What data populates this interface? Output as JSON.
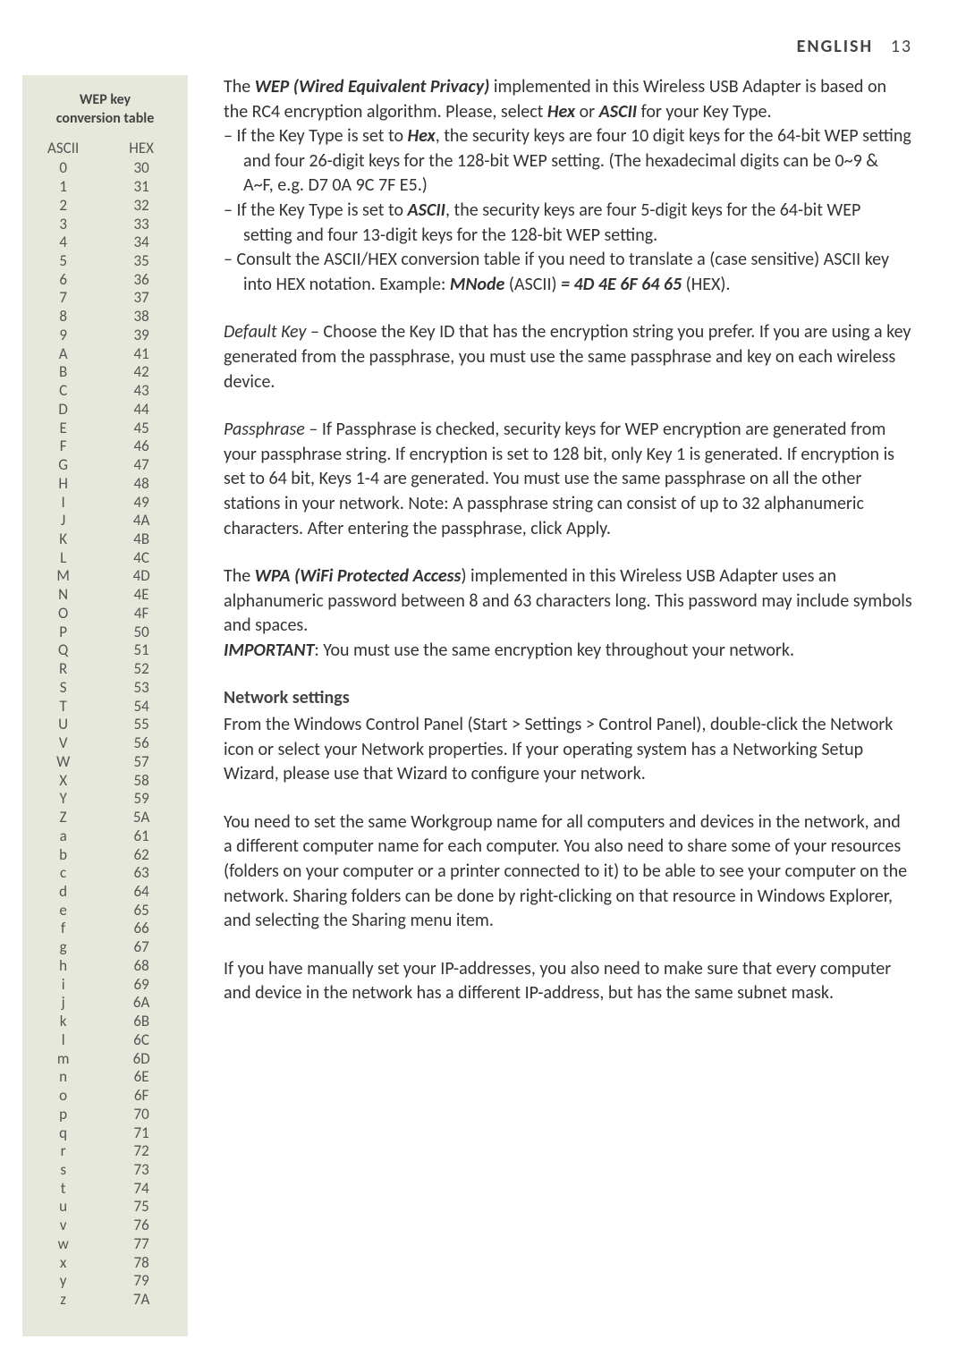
{
  "header": {
    "lang": "ENGLISH",
    "pagenum": "13"
  },
  "sidebar": {
    "title_l1": "WEP key",
    "title_l2": "conversion table",
    "cols": {
      "ascii_head": "ASCII",
      "hex_head": "HEX"
    },
    "rows": [
      {
        "a": "0",
        "h": "30"
      },
      {
        "a": "1",
        "h": "31"
      },
      {
        "a": "2",
        "h": "32"
      },
      {
        "a": "3",
        "h": "33"
      },
      {
        "a": "4",
        "h": "34"
      },
      {
        "a": "5",
        "h": "35"
      },
      {
        "a": "6",
        "h": "36"
      },
      {
        "a": "7",
        "h": "37"
      },
      {
        "a": "8",
        "h": "38"
      },
      {
        "a": "9",
        "h": "39"
      },
      {
        "a": "A",
        "h": "41"
      },
      {
        "a": "B",
        "h": "42"
      },
      {
        "a": "C",
        "h": "43"
      },
      {
        "a": "D",
        "h": "44"
      },
      {
        "a": "E",
        "h": "45"
      },
      {
        "a": "F",
        "h": "46"
      },
      {
        "a": "G",
        "h": "47"
      },
      {
        "a": "H",
        "h": "48"
      },
      {
        "a": "I",
        "h": "49"
      },
      {
        "a": "J",
        "h": "4A"
      },
      {
        "a": "K",
        "h": "4B"
      },
      {
        "a": "L",
        "h": "4C"
      },
      {
        "a": "M",
        "h": "4D"
      },
      {
        "a": "N",
        "h": "4E"
      },
      {
        "a": "O",
        "h": "4F"
      },
      {
        "a": "P",
        "h": "50"
      },
      {
        "a": "Q",
        "h": "51"
      },
      {
        "a": "R",
        "h": "52"
      },
      {
        "a": "S",
        "h": "53"
      },
      {
        "a": "T",
        "h": "54"
      },
      {
        "a": "U",
        "h": "55"
      },
      {
        "a": "V",
        "h": "56"
      },
      {
        "a": "W",
        "h": "57"
      },
      {
        "a": "X",
        "h": "58"
      },
      {
        "a": "Y",
        "h": "59"
      },
      {
        "a": "Z",
        "h": "5A"
      },
      {
        "a": "a",
        "h": "61"
      },
      {
        "a": "b",
        "h": "62"
      },
      {
        "a": "c",
        "h": "63"
      },
      {
        "a": "d",
        "h": "64"
      },
      {
        "a": "e",
        "h": "65"
      },
      {
        "a": "f",
        "h": "66"
      },
      {
        "a": "g",
        "h": "67"
      },
      {
        "a": "h",
        "h": "68"
      },
      {
        "a": "i",
        "h": "69"
      },
      {
        "a": "j",
        "h": "6A"
      },
      {
        "a": "k",
        "h": "6B"
      },
      {
        "a": "l",
        "h": "6C"
      },
      {
        "a": "m",
        "h": "6D"
      },
      {
        "a": "n",
        "h": "6E"
      },
      {
        "a": "o",
        "h": "6F"
      },
      {
        "a": "p",
        "h": "70"
      },
      {
        "a": "q",
        "h": "71"
      },
      {
        "a": "r",
        "h": "72"
      },
      {
        "a": "s",
        "h": "73"
      },
      {
        "a": "t",
        "h": "74"
      },
      {
        "a": "u",
        "h": "75"
      },
      {
        "a": "v",
        "h": "76"
      },
      {
        "a": "w",
        "h": "77"
      },
      {
        "a": "x",
        "h": "78"
      },
      {
        "a": "y",
        "h": "79"
      },
      {
        "a": "z",
        "h": "7A"
      }
    ]
  },
  "main": {
    "p1_a": "The ",
    "p1_b": "WEP (Wired Equivalent Privacy)",
    "p1_c": " implemented in this Wireless USB Adapter is based on the RC4 encryption algorithm. Please, select ",
    "p1_d": "Hex",
    "p1_e": " or ",
    "p1_f": "ASCII",
    "p1_g": " for your Key Type.",
    "li1_a": "– If the Key Type is set to ",
    "li1_b": "Hex",
    "li1_c": ", the security keys are four 10 digit keys for the 64-bit WEP setting and four 26-digit keys for the 128-bit WEP setting. (The hexadecimal digits can be 0~9 & A~F, e.g. D7 0A 9C 7F E5.)",
    "li2_a": "– If the Key Type is set to ",
    "li2_b": "ASCII",
    "li2_c": ", the security keys are four 5-digit keys for the 64-bit WEP setting and four 13-digit keys for the 128-bit WEP setting.",
    "li3_a": "– Consult the ASCII/HEX conversion table if you need to translate a (case sensitive) ASCII key into HEX notation. Example: ",
    "li3_b": "MNode",
    "li3_c": " (ASCII) ",
    "li3_d": "= 4D 4E 6F 64 65",
    "li3_e": " (HEX).",
    "p2_a": "Default Key",
    "p2_b": " – Choose the Key ID that has the encryption string you prefer. If you are using a key generated from the passphrase, you must use the same passphrase and key on each wireless device.",
    "p3_a": "Passphrase",
    "p3_b": " – If Passphrase is checked, security keys for WEP encryption are generated from your passphrase string. If encryption is set to 128 bit, only Key 1 is generated. If encryption is set to 64 bit, Keys 1-4 are generated. You must use the same passphrase on all the other stations in your network. Note: A passphrase string can consist of up to 32 alphanumeric characters. After entering the passphrase, click Apply.",
    "p4_a": "The ",
    "p4_b": "WPA (WiFi Protected Access",
    "p4_c": ") implemented in this Wireless USB Adapter uses an alphanumeric password between 8 and 63 characters long. This password may include symbols and spaces.",
    "p5_a": "IMPORTANT",
    "p5_b": ": You must use the same encryption key throughout your network.",
    "h1": "Network settings",
    "p6": "From the Windows Control Panel (Start > Settings > Control Panel), double-click the Network icon or select your Network properties. If your operating system has a Networking Setup Wizard, please use that Wizard to configure your network.",
    "p7": "You need to set the same Workgroup name for all computers and devices in the network, and a different computer name for each computer. You also need to share some of your resources (folders on your computer or a printer connected to it) to be able to see your computer on the network. Sharing folders can be done by right-clicking on that resource in Windows Explorer, and selecting the Sharing menu item.",
    "p8": "If you have manually set your IP-addresses, you also need to make sure that every computer and device in the network has a different IP-address, but has the same subnet mask."
  }
}
